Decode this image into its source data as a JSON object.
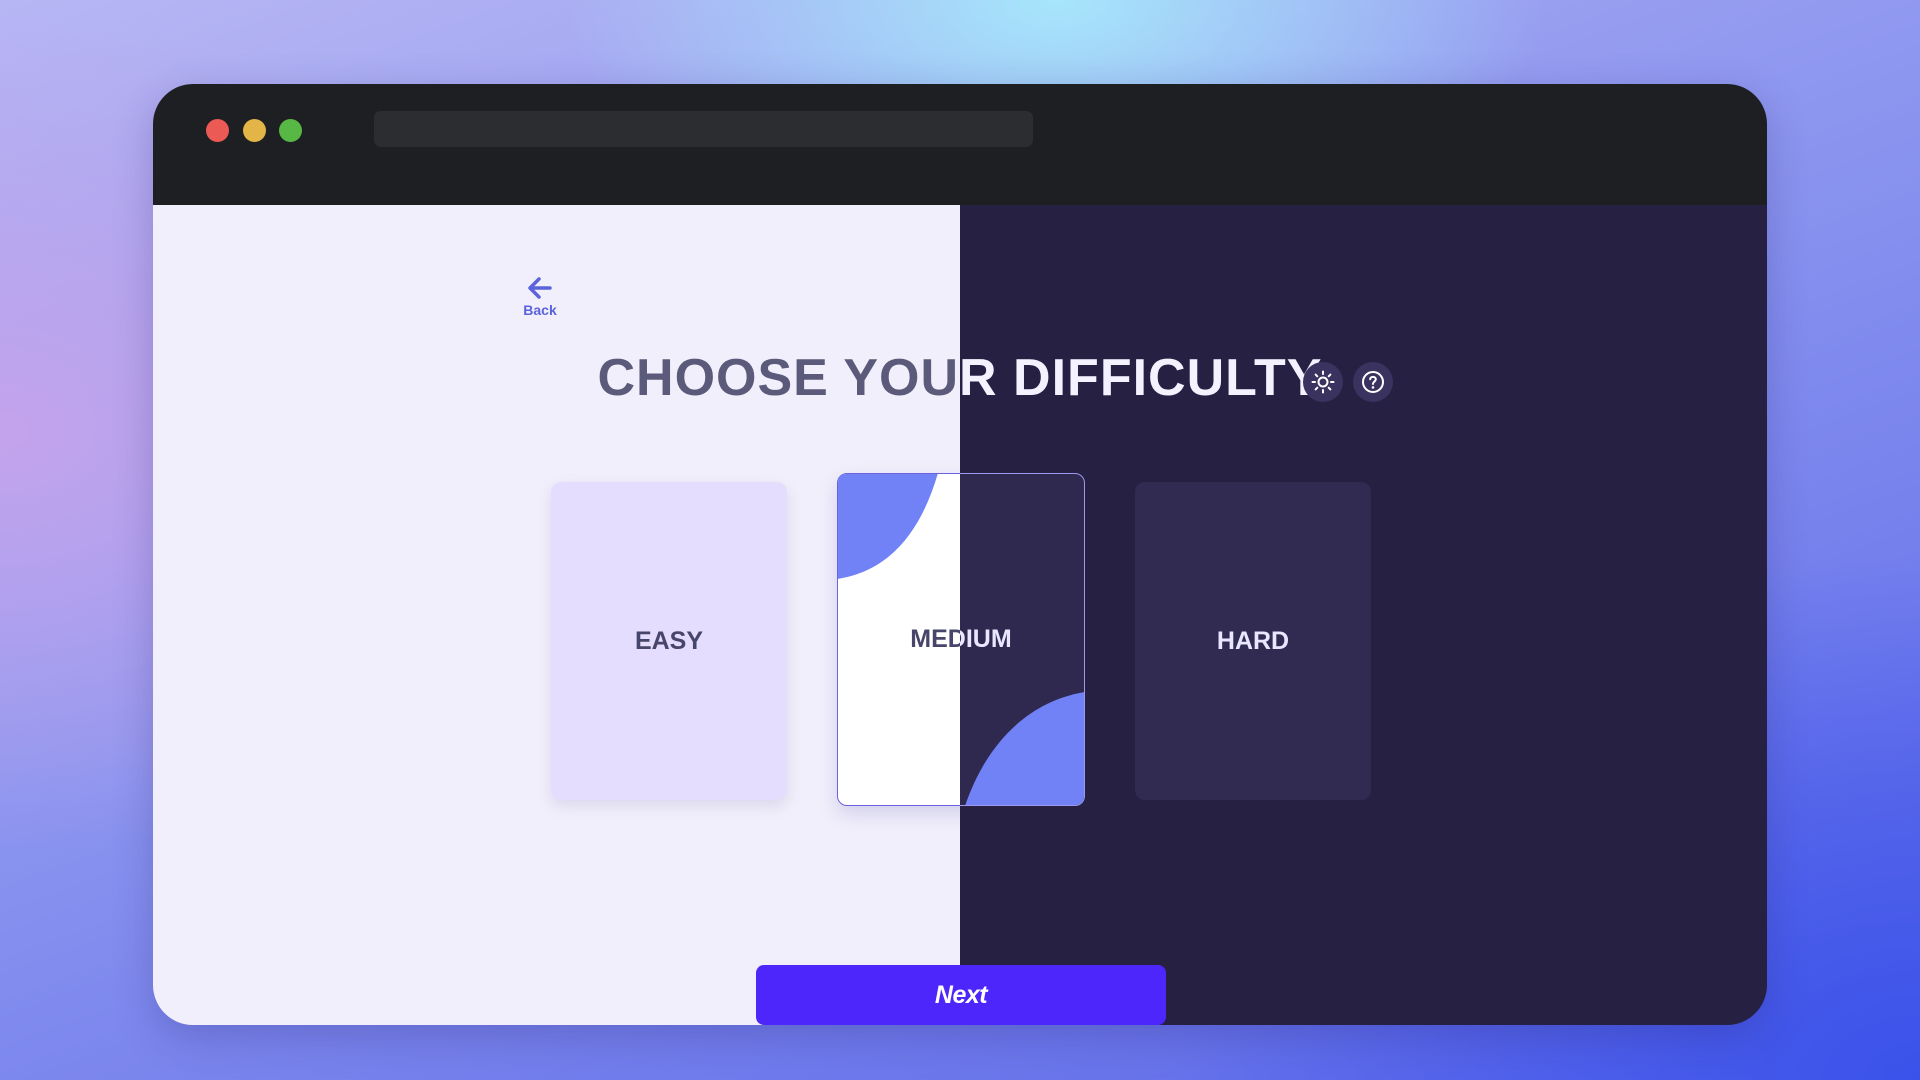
{
  "nav": {
    "back_label": "Back"
  },
  "header": {
    "title": "CHOOSE YOUR DIFFICULTY"
  },
  "toolbar": {
    "theme_icon": "sun-icon",
    "help_icon": "help-circle-icon"
  },
  "difficulty": {
    "options": [
      {
        "label": "EASY",
        "selected": false
      },
      {
        "label": "MEDIUM",
        "selected": true
      },
      {
        "label": "HARD",
        "selected": false
      }
    ]
  },
  "actions": {
    "next_label": "Next"
  },
  "colors": {
    "accent": "#4c26fa",
    "light_bg": "#f1effb",
    "dark_bg": "#262042",
    "blob": "#7182f7"
  }
}
